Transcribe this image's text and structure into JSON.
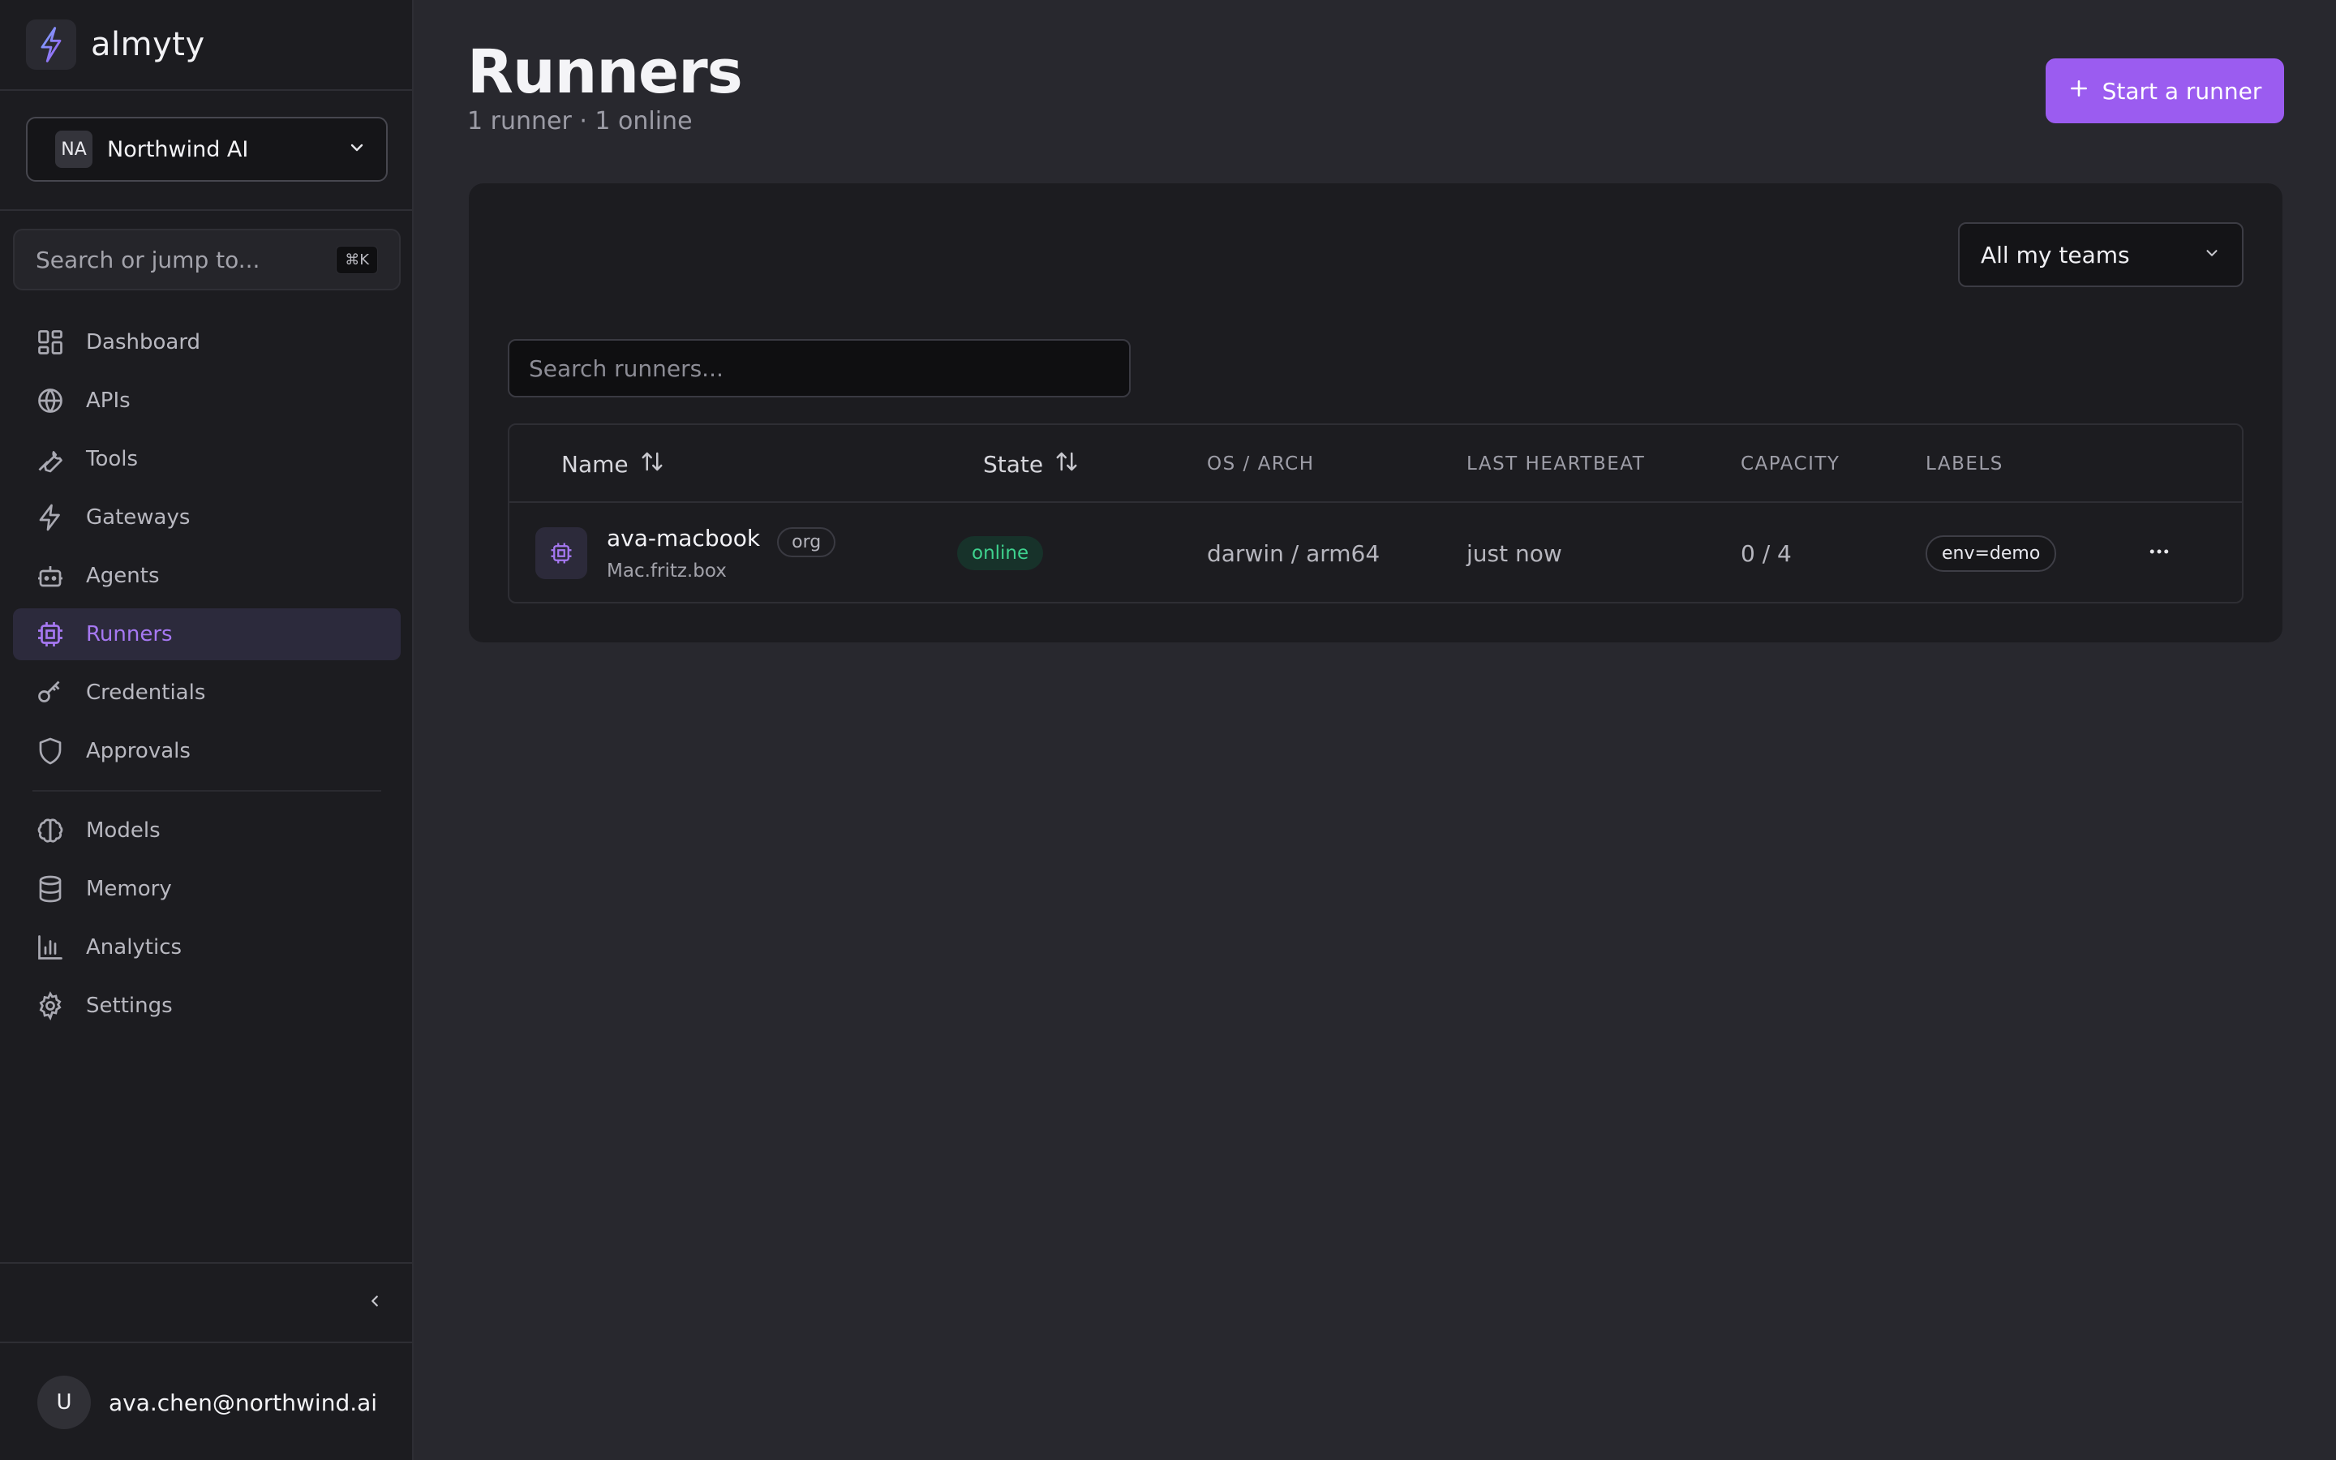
{
  "brand": {
    "name": "almyty",
    "logo_icon": "bolt-logo-icon"
  },
  "org": {
    "initials": "NA",
    "name": "Northwind AI"
  },
  "search": {
    "placeholder": "Search or jump to...",
    "shortcut": "⌘K"
  },
  "nav": {
    "items": [
      {
        "label": "Dashboard",
        "icon": "grid-icon"
      },
      {
        "label": "APIs",
        "icon": "globe-icon"
      },
      {
        "label": "Tools",
        "icon": "wrench-icon"
      },
      {
        "label": "Gateways",
        "icon": "bolt-icon"
      },
      {
        "label": "Agents",
        "icon": "robot-icon"
      },
      {
        "label": "Runners",
        "icon": "cpu-icon",
        "active": true
      },
      {
        "label": "Credentials",
        "icon": "key-icon"
      },
      {
        "label": "Approvals",
        "icon": "shield-icon"
      },
      {
        "label": "Models",
        "icon": "brain-icon"
      },
      {
        "label": "Memory",
        "icon": "database-icon"
      },
      {
        "label": "Analytics",
        "icon": "bar-chart-icon"
      },
      {
        "label": "Settings",
        "icon": "gear-icon"
      }
    ]
  },
  "user": {
    "initial": "U",
    "email": "ava.chen@northwind.ai"
  },
  "page": {
    "title": "Runners",
    "subtitle": "1 runner · 1 online",
    "start_button": "Start a runner"
  },
  "filter": {
    "team_value": "All my teams"
  },
  "runner_search": {
    "placeholder": "Search runners..."
  },
  "table": {
    "columns": {
      "name": "Name",
      "state": "State",
      "os_arch": "OS / ARCH",
      "heartbeat": "LAST HEARTBEAT",
      "capacity": "CAPACITY",
      "labels": "LABELS"
    },
    "rows": [
      {
        "name": "ava-macbook",
        "scope": "org",
        "host": "Mac.fritz.box",
        "state": "online",
        "os_arch": "darwin / arm64",
        "heartbeat": "just now",
        "capacity": "0 / 4",
        "label": "env=demo"
      }
    ]
  },
  "colors": {
    "accent": "#9b5cf0",
    "accent_text": "#a678f2",
    "online": "#3ed28e",
    "background": "#28282e",
    "sidebar": "#1c1c20"
  }
}
